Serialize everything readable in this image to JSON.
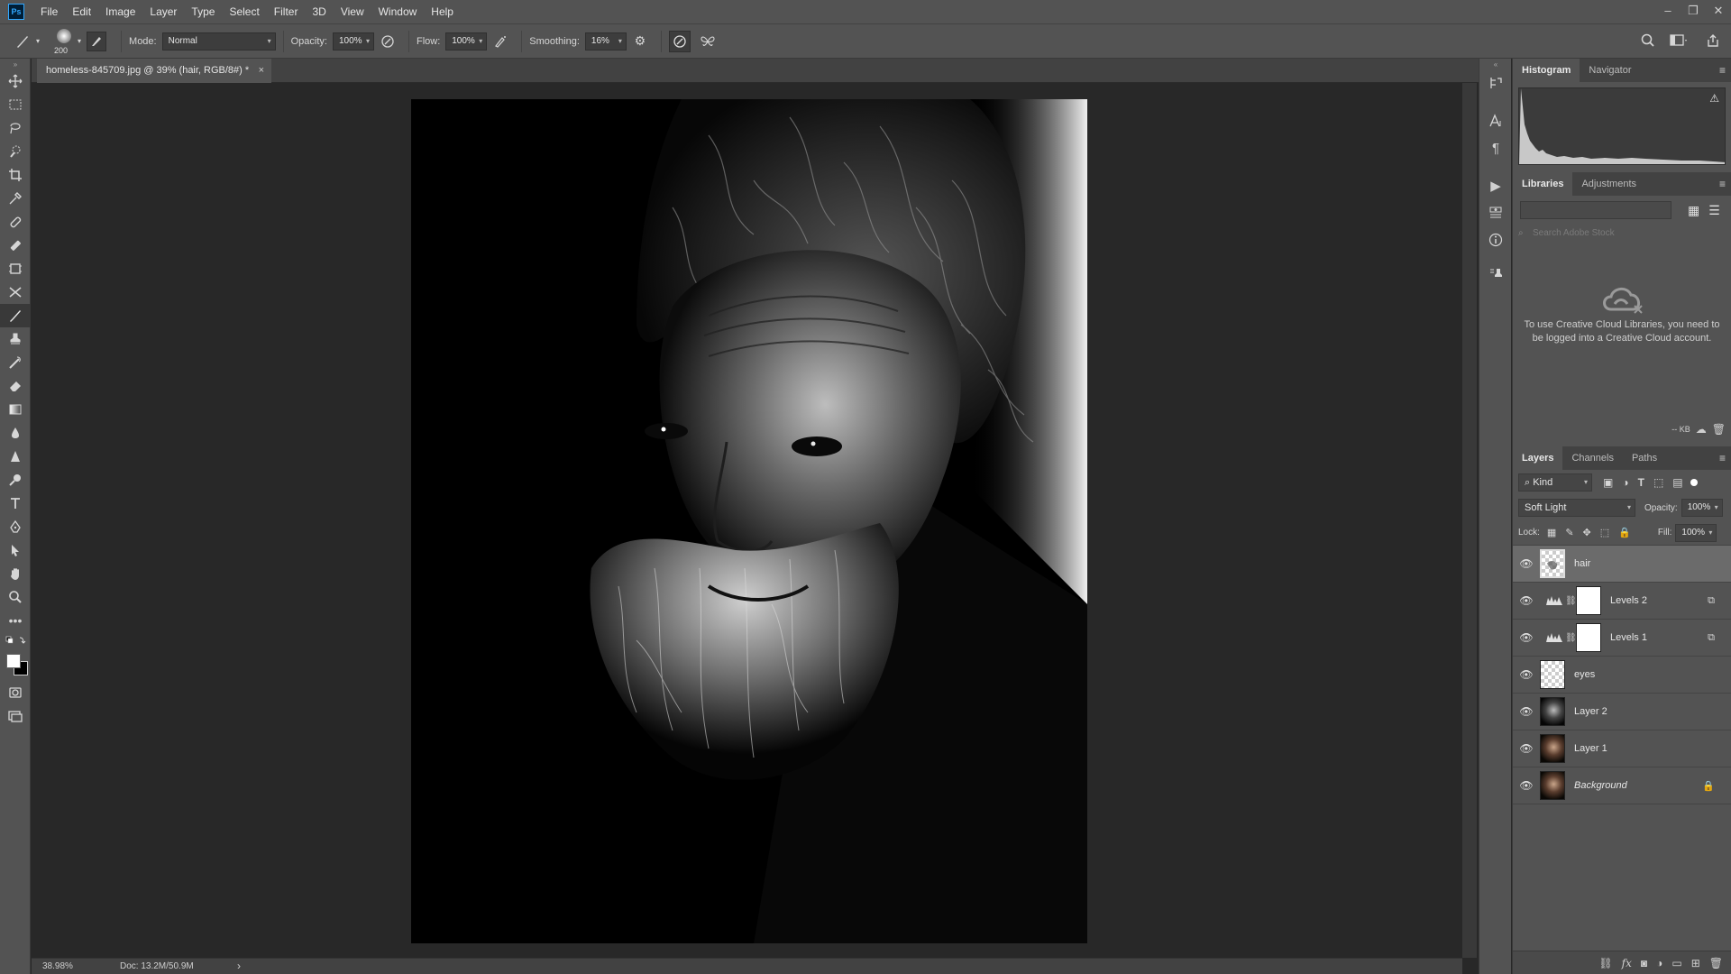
{
  "menubar": {
    "logo": "Ps",
    "items": [
      "File",
      "Edit",
      "Image",
      "Layer",
      "Type",
      "Select",
      "Filter",
      "3D",
      "View",
      "Window",
      "Help"
    ]
  },
  "options": {
    "brush_size": "200",
    "mode_label": "Mode:",
    "mode_value": "Normal",
    "opacity_label": "Opacity:",
    "opacity_value": "100%",
    "flow_label": "Flow:",
    "flow_value": "100%",
    "smoothing_label": "Smoothing:",
    "smoothing_value": "16%"
  },
  "document": {
    "tab_title": "homeless-845709.jpg @ 39% (hair, RGB/8#) *",
    "close": "×"
  },
  "status": {
    "zoom": "38.98%",
    "doc_size": "Doc: 13.2M/50.9M",
    "arrow": "›"
  },
  "histogram_panel": {
    "tabs": [
      "Histogram",
      "Navigator"
    ],
    "warning": "⚠"
  },
  "libraries_panel": {
    "tabs": [
      "Libraries",
      "Adjustments"
    ],
    "search_placeholder": "Search Adobe Stock",
    "message": "To use Creative Cloud Libraries, you need to be logged into a Creative Cloud account.",
    "footer_size": "-- KB"
  },
  "layers_panel": {
    "tabs": [
      "Layers",
      "Channels",
      "Paths"
    ],
    "filter_kind": "Kind",
    "blend_mode": "Soft Light",
    "opacity_label": "Opacity:",
    "opacity_value": "100%",
    "lock_label": "Lock:",
    "fill_label": "Fill:",
    "fill_value": "100%",
    "layers": [
      {
        "name": "hair"
      },
      {
        "name": "Levels 2"
      },
      {
        "name": "Levels 1"
      },
      {
        "name": "eyes"
      },
      {
        "name": "Layer 2"
      },
      {
        "name": "Layer 1"
      },
      {
        "name": "Background"
      }
    ]
  },
  "colors": {
    "panel_bg": "#535353",
    "canvas_bg": "#282828",
    "selected_layer": "#6b6b6b",
    "ps_blue": "#31a8ff"
  }
}
